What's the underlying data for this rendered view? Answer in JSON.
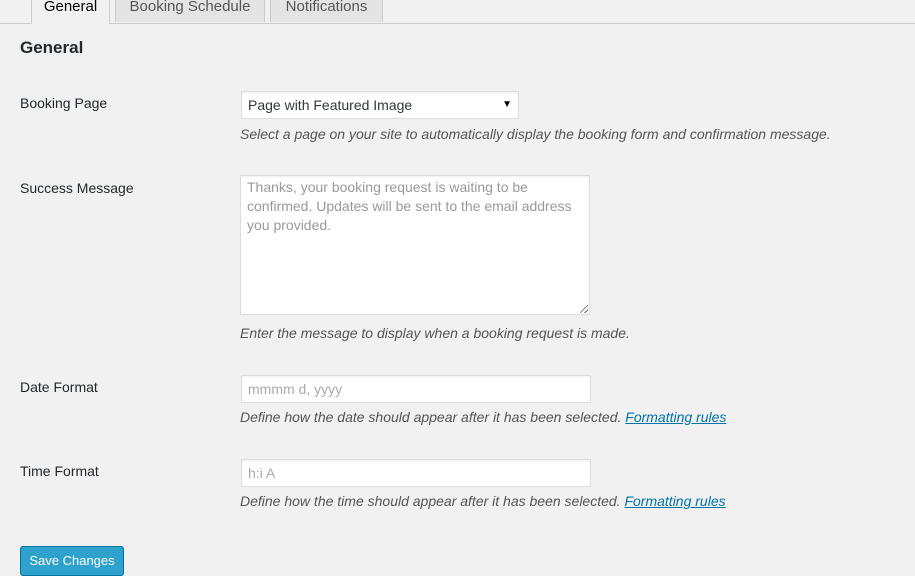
{
  "tabs": [
    {
      "label": "General",
      "active": true
    },
    {
      "label": "Booking Schedule",
      "active": false
    },
    {
      "label": "Notifications",
      "active": false
    }
  ],
  "section_title": "General",
  "fields": {
    "booking_page": {
      "label": "Booking Page",
      "selected": "Page with Featured Image",
      "description": "Select a page on your site to automatically display the booking form and confirmation message."
    },
    "success_message": {
      "label": "Success Message",
      "placeholder": "Thanks, your booking request is waiting to be confirmed. Updates will be sent to the email address you provided.",
      "description": "Enter the message to display when a booking request is made."
    },
    "date_format": {
      "label": "Date Format",
      "placeholder": "mmmm d, yyyy",
      "description": "Define how the date should appear after it has been selected.",
      "link": "Formatting rules"
    },
    "time_format": {
      "label": "Time Format",
      "placeholder": "h:i A",
      "description": "Define how the time should appear after it has been selected.",
      "link": "Formatting rules"
    }
  },
  "save_button": "Save Changes",
  "colors": {
    "background": "#f1f1f1",
    "primary_button": "#2ea2cc",
    "link": "#0073aa"
  }
}
